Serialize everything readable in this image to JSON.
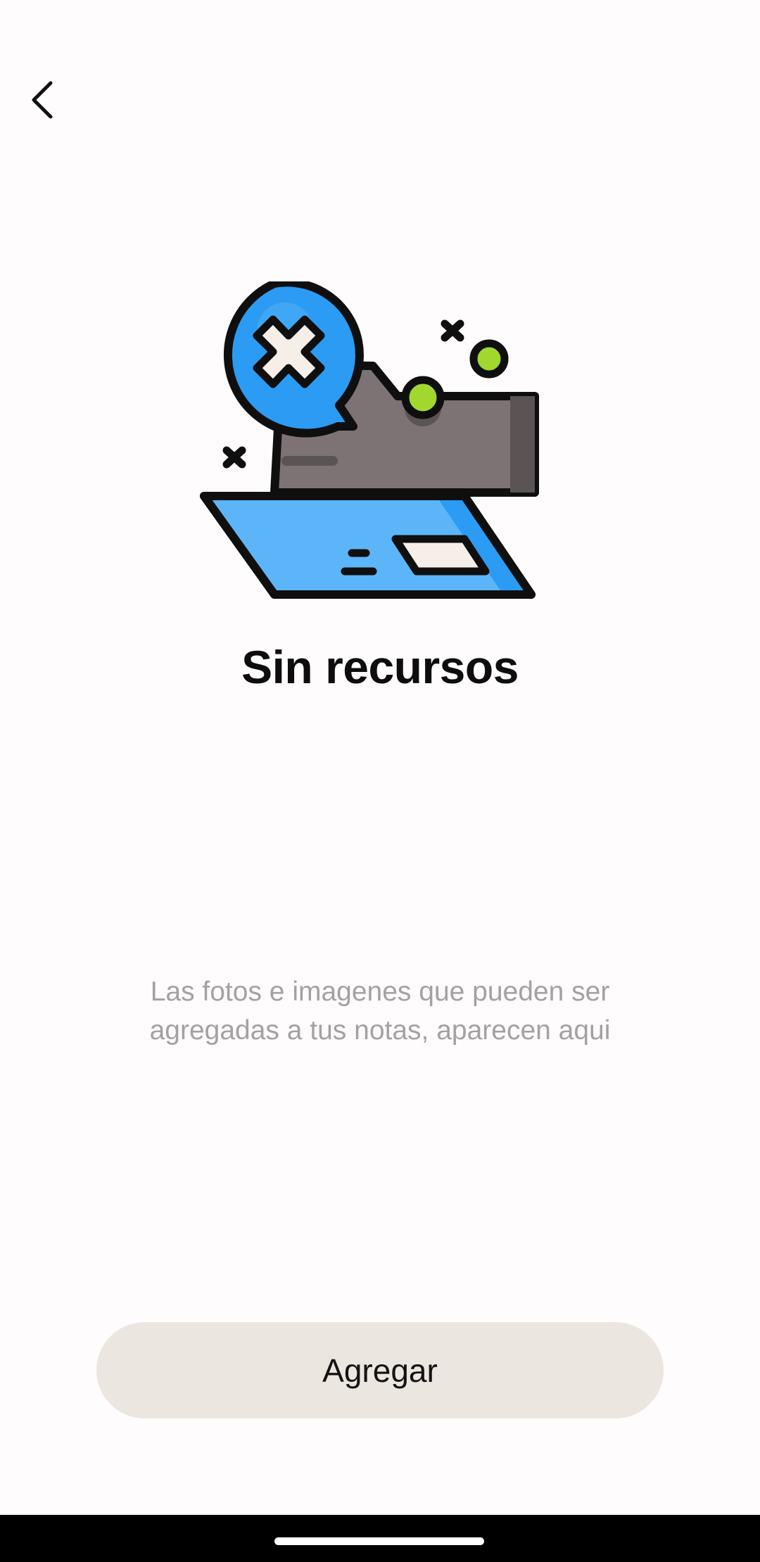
{
  "header": {
    "back_icon": "chevron-left-icon"
  },
  "illustration": {
    "icon": "empty-folder-illustration-icon",
    "colors": {
      "blue": "#2b9bf3",
      "blue_light": "#5cb5f8",
      "folder_gray": "#7d7374",
      "folder_dark": "#5b5455",
      "green": "#a0d82e",
      "cream": "#f5eee9",
      "outline": "#0f0f0f"
    }
  },
  "empty_state": {
    "title": "Sin recursos",
    "description": "Las fotos e imagenes que pueden ser agregadas a tus notas, aparecen aqui"
  },
  "actions": {
    "add_label": "Agregar"
  },
  "theme": {
    "background": "#fefcfc",
    "button_bg": "#ece6e1",
    "title_color": "#0d0d0d",
    "description_color": "#a3a1a1"
  }
}
